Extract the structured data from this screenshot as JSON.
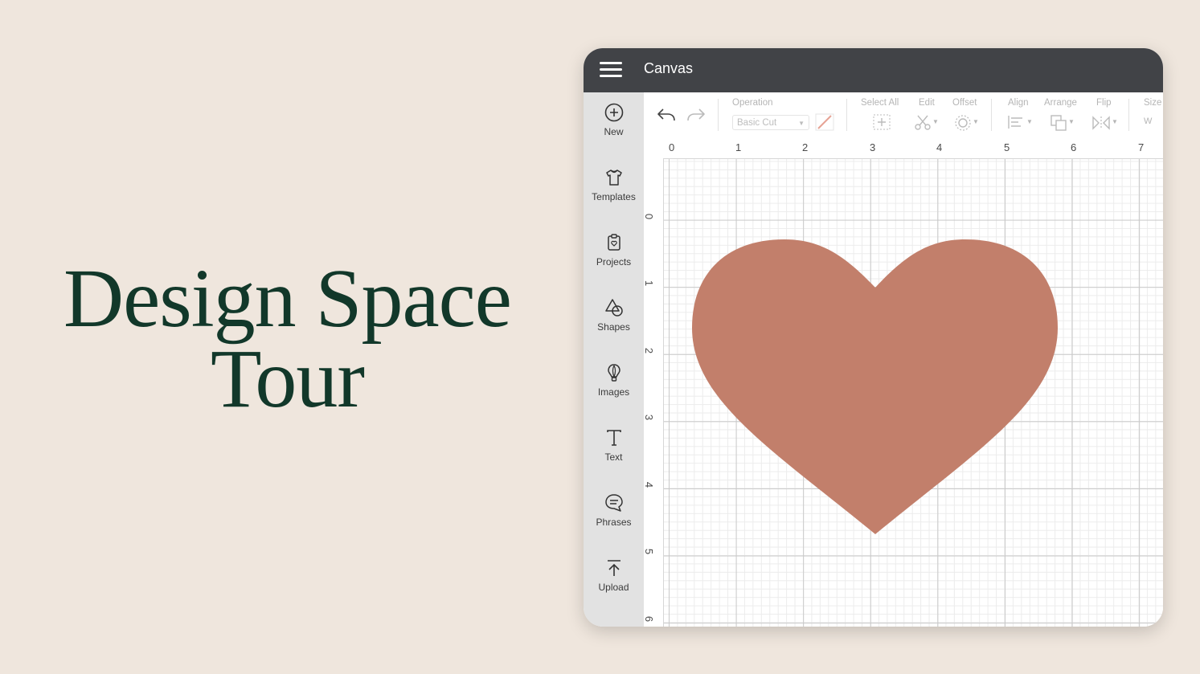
{
  "hero": {
    "line1": "Design Space",
    "line2": "Tour"
  },
  "window": {
    "title": "Canvas"
  },
  "sidebar": {
    "items": [
      {
        "label": "New",
        "icon": "plus-circle-icon"
      },
      {
        "label": "Templates",
        "icon": "tshirt-icon"
      },
      {
        "label": "Projects",
        "icon": "clipboard-icon"
      },
      {
        "label": "Shapes",
        "icon": "shapes-icon"
      },
      {
        "label": "Images",
        "icon": "lightbulb-icon"
      },
      {
        "label": "Text",
        "icon": "text-icon"
      },
      {
        "label": "Phrases",
        "icon": "speech-bubble-icon"
      },
      {
        "label": "Upload",
        "icon": "upload-icon"
      }
    ]
  },
  "toolbar": {
    "operation_label": "Operation",
    "operation_value": "Basic Cut",
    "select_all_label": "Select All",
    "edit_label": "Edit",
    "offset_label": "Offset",
    "align_label": "Align",
    "arrange_label": "Arrange",
    "flip_label": "Flip",
    "size_label": "Size",
    "size_w": "W"
  },
  "rulers": {
    "top": [
      "0",
      "1",
      "2",
      "3",
      "4",
      "5",
      "6",
      "7"
    ],
    "left": [
      "0",
      "1",
      "2",
      "3",
      "4",
      "5",
      "6"
    ]
  },
  "colors": {
    "background": "#efe6dd",
    "title": "#12382a",
    "titlebar": "#414347",
    "sidebar": "#e2e2e2",
    "heart": "#c27f6b"
  }
}
